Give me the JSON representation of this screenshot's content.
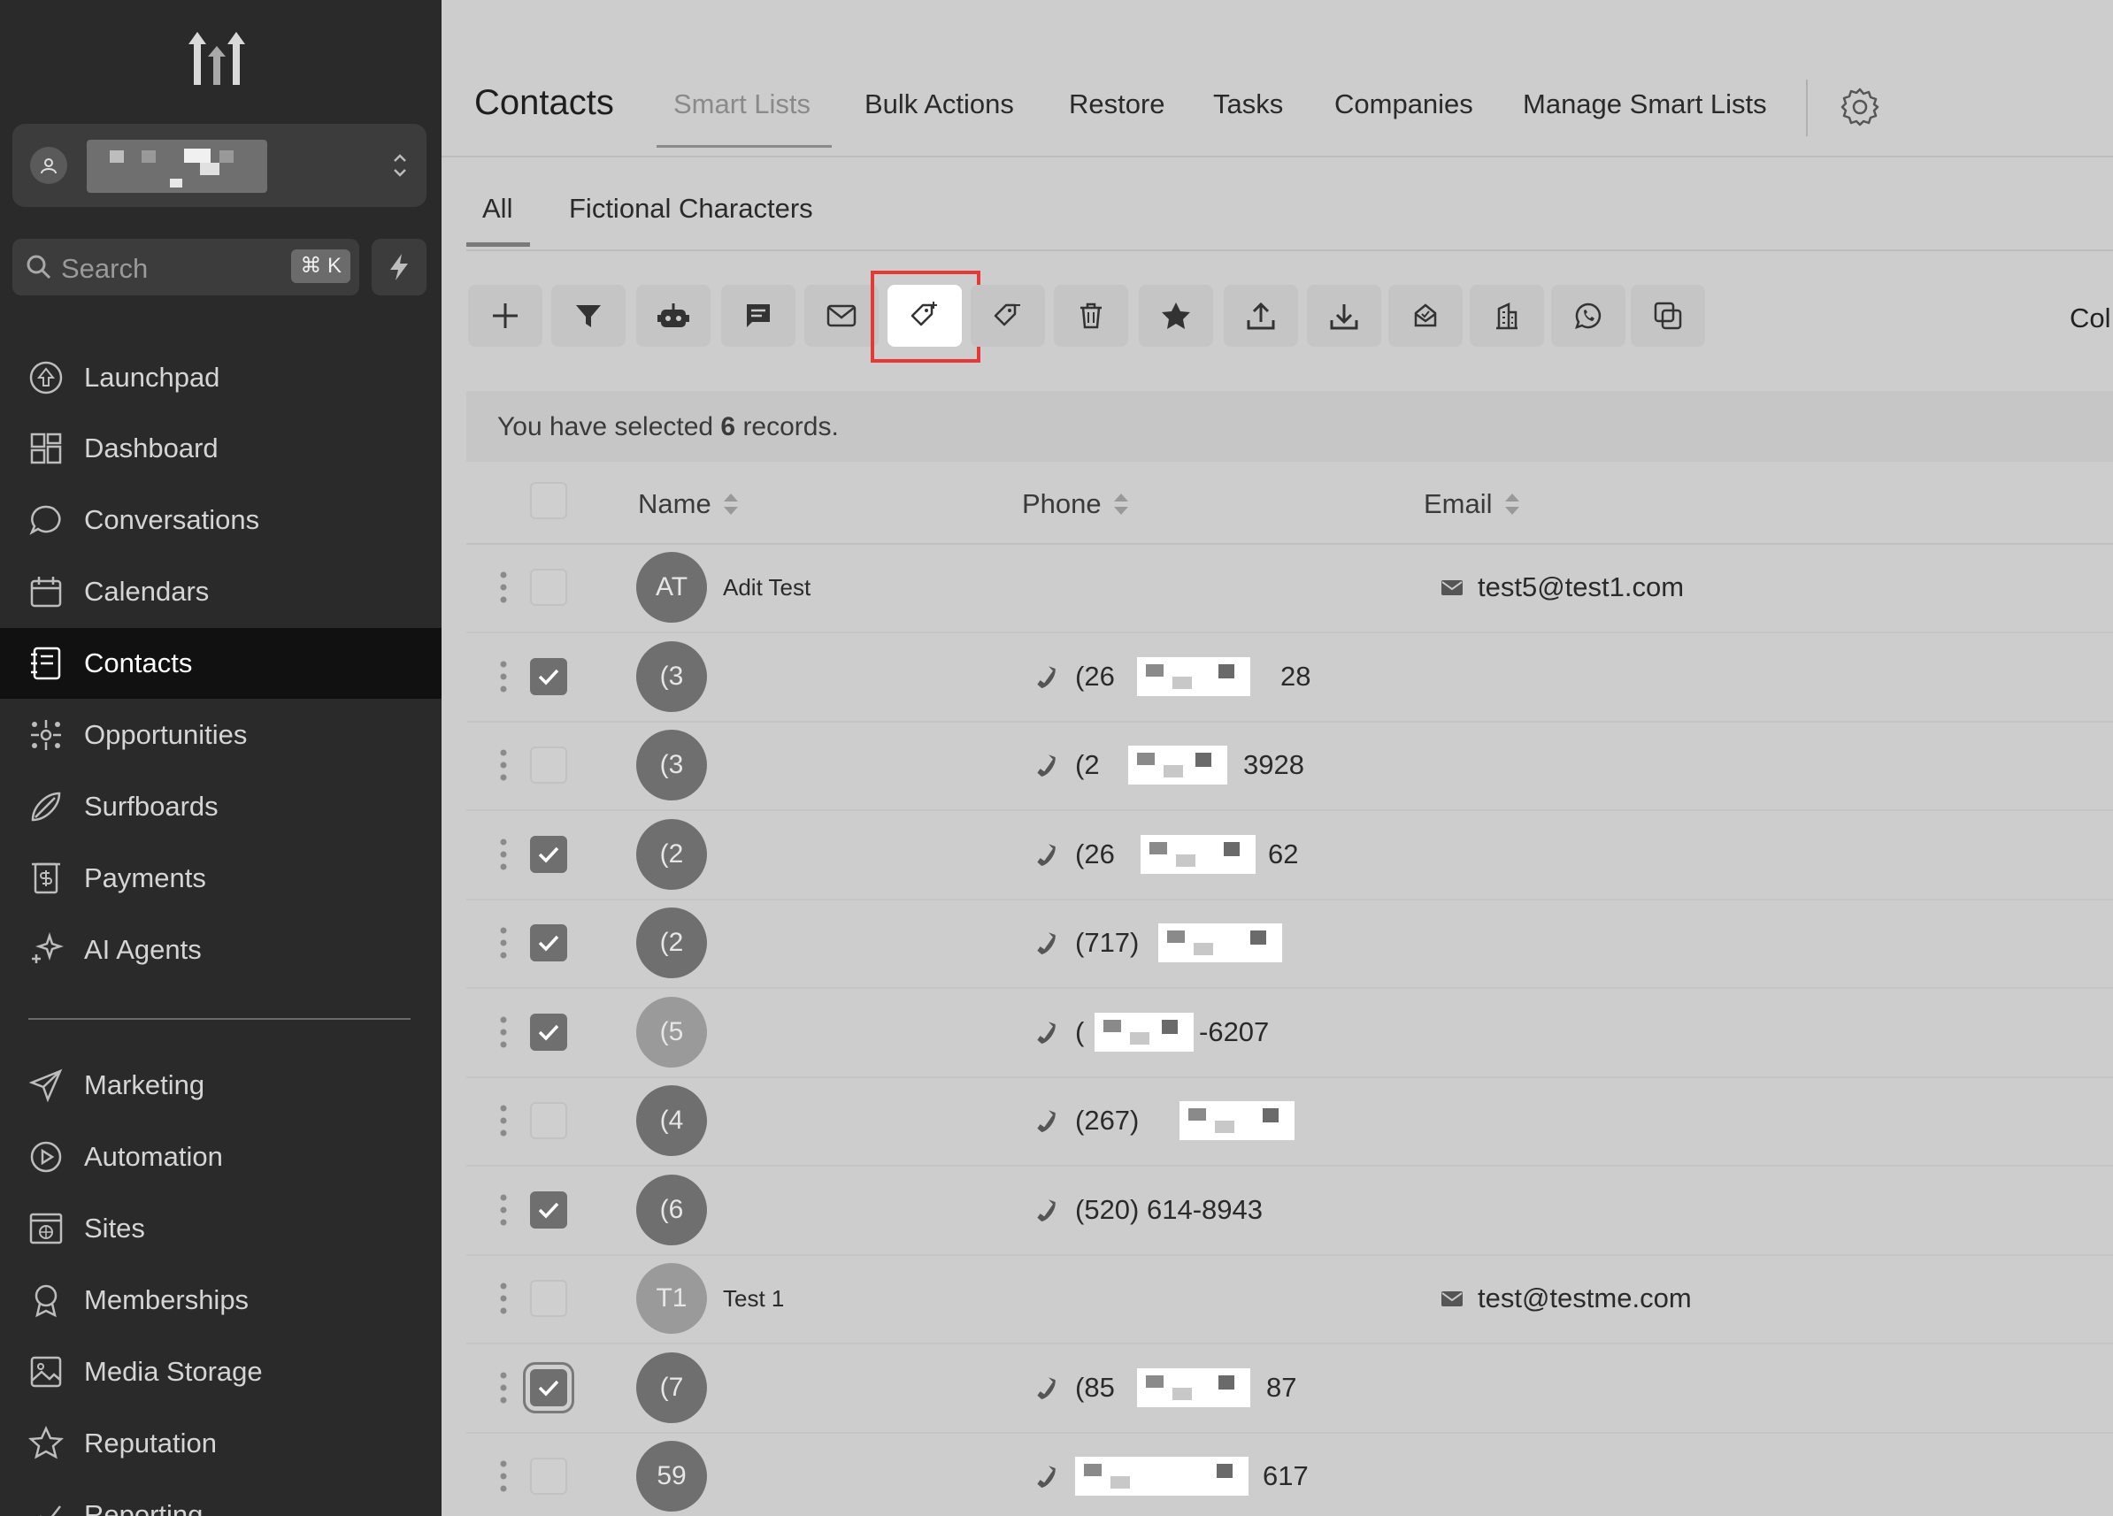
{
  "sidebar": {
    "search_placeholder": "Search",
    "search_shortcut": "⌘ K",
    "items": [
      {
        "label": "Launchpad",
        "icon": "launchpad-icon"
      },
      {
        "label": "Dashboard",
        "icon": "dashboard-icon"
      },
      {
        "label": "Conversations",
        "icon": "conversations-icon"
      },
      {
        "label": "Calendars",
        "icon": "calendar-icon"
      },
      {
        "label": "Contacts",
        "icon": "contacts-icon",
        "active": true
      },
      {
        "label": "Opportunities",
        "icon": "opportunities-icon"
      },
      {
        "label": "Surfboards",
        "icon": "surfboard-icon"
      },
      {
        "label": "Payments",
        "icon": "payments-icon"
      },
      {
        "label": "AI Agents",
        "icon": "ai-agents-icon"
      },
      {
        "label": "Marketing",
        "icon": "marketing-icon"
      },
      {
        "label": "Automation",
        "icon": "automation-icon"
      },
      {
        "label": "Sites",
        "icon": "sites-icon"
      },
      {
        "label": "Memberships",
        "icon": "memberships-icon"
      },
      {
        "label": "Media Storage",
        "icon": "media-storage-icon"
      },
      {
        "label": "Reputation",
        "icon": "reputation-icon"
      },
      {
        "label": "Reporting",
        "icon": "reporting-icon"
      }
    ]
  },
  "topnav": {
    "title": "Contacts",
    "tabs": [
      "Smart Lists",
      "Bulk Actions",
      "Restore",
      "Tasks",
      "Companies",
      "Manage Smart Lists"
    ],
    "active_tab": "Smart Lists"
  },
  "subtabs": [
    "All",
    "Fictional Characters"
  ],
  "toolbar": {
    "buttons": [
      "add-icon",
      "filter-icon",
      "bot-icon",
      "sms-icon",
      "email-icon",
      "add-tag-icon",
      "remove-tag-icon",
      "delete-icon",
      "star-icon",
      "upload-icon",
      "download-icon",
      "mailbox-icon",
      "company-icon",
      "whatsapp-icon",
      "copy-icon"
    ],
    "highlighted": "add-tag-icon",
    "columns_label": "Col"
  },
  "banner": {
    "prefix": "You have selected ",
    "count": "6",
    "suffix": " records."
  },
  "table": {
    "columns": [
      "Name",
      "Phone",
      "Email"
    ],
    "rows": [
      {
        "avatar": "AT",
        "name": "Adit Test",
        "phone": "",
        "email": "test5@test1.com",
        "checked": false
      },
      {
        "avatar": "(3",
        "name": "",
        "phone": "(26",
        "phone_end": "28",
        "email": "",
        "checked": true
      },
      {
        "avatar": "(3",
        "name": "",
        "phone": "(2",
        "phone_end": "3928",
        "email": "",
        "checked": false
      },
      {
        "avatar": "(2",
        "name": "",
        "phone": "(26",
        "phone_end": "62",
        "email": "",
        "checked": true
      },
      {
        "avatar": "(2",
        "name": "",
        "phone": "(717)",
        "phone_end": "",
        "email": "",
        "checked": true
      },
      {
        "avatar": "(5",
        "name": "",
        "phone": "(",
        "phone_end": "-6207",
        "email": "",
        "checked": true,
        "light": true
      },
      {
        "avatar": "(4",
        "name": "",
        "phone": "(267)",
        "phone_end": "",
        "email": "",
        "checked": false
      },
      {
        "avatar": "(6",
        "name": "",
        "phone": "(520) 614-8943",
        "phone_end": "",
        "email": "",
        "checked": true
      },
      {
        "avatar": "T1",
        "name": "Test 1",
        "phone": "",
        "email": "test@testme.com",
        "checked": false,
        "light": true
      },
      {
        "avatar": "(7",
        "name": "",
        "phone": "(85",
        "phone_end": "87",
        "email": "",
        "checked": true,
        "focused": true
      },
      {
        "avatar": "59",
        "name": "",
        "phone": "",
        "phone_end": "617",
        "email": "",
        "checked": false
      }
    ]
  }
}
